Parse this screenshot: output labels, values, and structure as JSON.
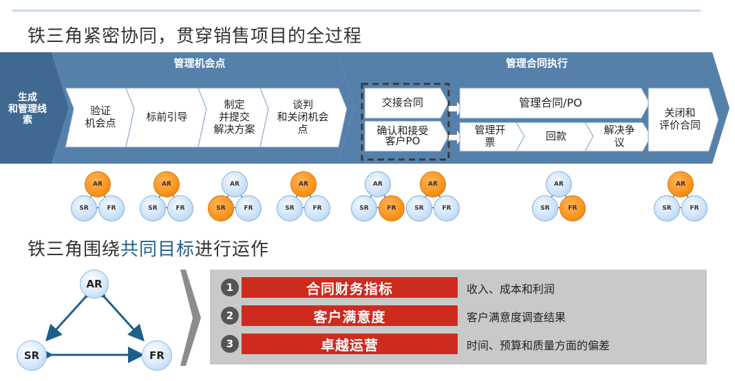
{
  "title": "铁三角紧密协同，贯穿销售项目的全过程",
  "subtitle": {
    "prefix": "铁三角围绕",
    "highlight": "共同目标",
    "suffix": "进行运作"
  },
  "left_label": "生成\n和管理线\n索",
  "section1": {
    "header": "管理机会点",
    "steps": [
      "验证\n机会点",
      "标前引导",
      "制定\n并提交\n解决方案",
      "谈判\n和关闭机会\n点"
    ]
  },
  "section2": {
    "header": "管理合同执行",
    "top_box": "交接合同",
    "bottom_box": "确认和接受\n客户PO",
    "po_header": "管理合同/PO",
    "po_steps": [
      "管理开\n票",
      "回款",
      "解决争\n议"
    ],
    "close_box": "关闭和\n评价合同"
  },
  "triangle_labels": {
    "ar": "AR",
    "sr": "SR",
    "fr": "FR"
  },
  "triangles": [
    {
      "highlight": "AR"
    },
    {
      "highlight": "AR"
    },
    {
      "highlight": "SR"
    },
    {
      "highlight": "AR"
    },
    {
      "highlight": "FR"
    },
    {
      "highlight": "AR"
    },
    {
      "highlight": "FR"
    },
    {
      "highlight": "AR"
    }
  ],
  "goals": [
    {
      "num": "1",
      "label": "合同财务指标",
      "desc": "收入、成本和利润"
    },
    {
      "num": "2",
      "label": "客户满意度",
      "desc": "客户满意度调查结果"
    },
    {
      "num": "3",
      "label": "卓越运营",
      "desc": "时间、预算和质量方面的偏差"
    }
  ],
  "colors": {
    "band": "#5580aa",
    "band_dark": "#436c95",
    "orange": "#f7941d",
    "red": "#cc2b1e"
  }
}
